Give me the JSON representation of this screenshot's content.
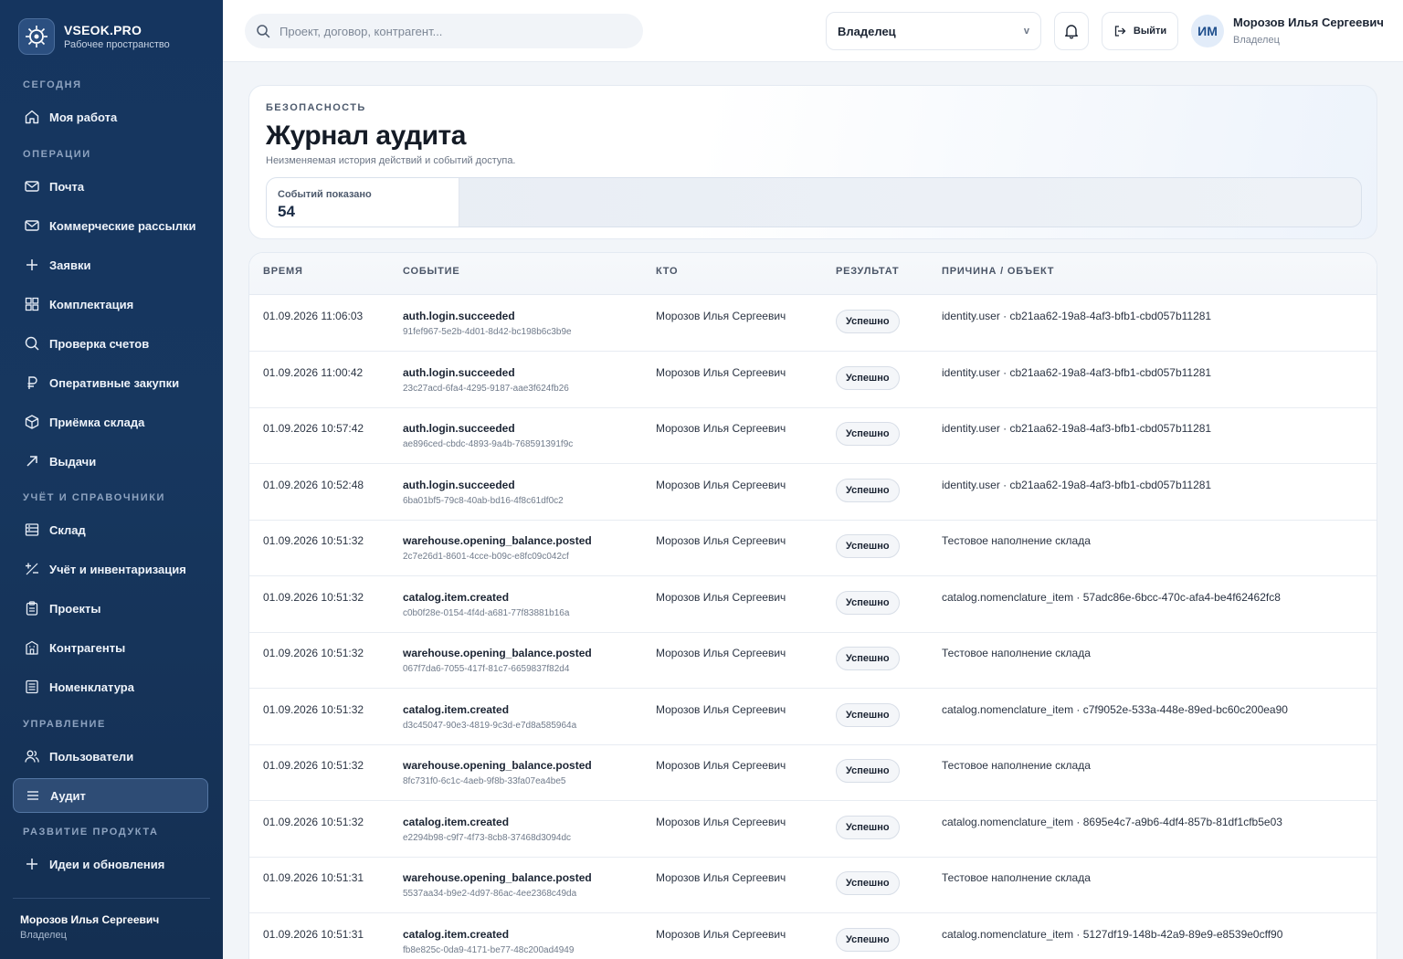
{
  "brand": {
    "name": "VSEOK.PRO",
    "subtitle": "Рабочее пространство"
  },
  "sidebar": {
    "sections": [
      {
        "title": "СЕГОДНЯ",
        "items": [
          {
            "label": "Моя работа",
            "icon": "home-icon"
          }
        ]
      },
      {
        "title": "ОПЕРАЦИИ",
        "items": [
          {
            "label": "Почта",
            "icon": "mail-icon"
          },
          {
            "label": "Коммерческие рассылки",
            "icon": "mail-icon"
          },
          {
            "label": "Заявки",
            "icon": "plus-icon"
          },
          {
            "label": "Комплектация",
            "icon": "grid-icon"
          },
          {
            "label": "Проверка счетов",
            "icon": "search-icon"
          },
          {
            "label": "Оперативные закупки",
            "icon": "ruble-icon"
          },
          {
            "label": "Приёмка склада",
            "icon": "box-icon"
          },
          {
            "label": "Выдачи",
            "icon": "arrow-up-right-icon"
          }
        ]
      },
      {
        "title": "УЧЁТ И СПРАВОЧНИКИ",
        "items": [
          {
            "label": "Склад",
            "icon": "warehouse-icon"
          },
          {
            "label": "Учёт и инвентаризация",
            "icon": "plus-minus-icon"
          },
          {
            "label": "Проекты",
            "icon": "clipboard-icon"
          },
          {
            "label": "Контрагенты",
            "icon": "building-icon"
          },
          {
            "label": "Номенклатура",
            "icon": "list-icon"
          }
        ]
      },
      {
        "title": "УПРАВЛЕНИЕ",
        "items": [
          {
            "label": "Пользователи",
            "icon": "users-icon"
          },
          {
            "label": "Аудит",
            "icon": "menu-icon",
            "active": true
          }
        ]
      },
      {
        "title": "РАЗВИТИЕ ПРОДУКТА",
        "items": [
          {
            "label": "Идеи и обновления",
            "icon": "plus-icon"
          }
        ]
      }
    ],
    "footer": {
      "name": "Морозов Илья Сергеевич",
      "role": "Владелец"
    }
  },
  "topbar": {
    "search_placeholder": "Проект, договор, контрагент...",
    "role_select": "Владелец",
    "role_chevron": "v",
    "logout_label": "Выйти",
    "avatar_initials": "ИМ",
    "user_name": "Морозов Илья Сергеевич",
    "user_role": "Владелец"
  },
  "header": {
    "eyebrow": "БЕЗОПАСНОСТЬ",
    "title": "Журнал аудита",
    "subtitle": "Неизменяемая история действий и событий доступа.",
    "stat_label": "Событий показано",
    "stat_value": "54"
  },
  "table": {
    "columns": [
      "ВРЕМЯ",
      "СОБЫТИЕ",
      "КТО",
      "РЕЗУЛЬТАТ",
      "ПРИЧИНА / ОБЪЕКТ"
    ],
    "rows": [
      {
        "time": "01.09.2026 11:06:03",
        "event": "auth.login.succeeded",
        "id": "91fef967-5e2b-4d01-8d42-bc198b6c3b9e",
        "who": "Морозов Илья Сергеевич",
        "result": "Успешно",
        "reason": "identity.user · cb21aa62-19a8-4af3-bfb1-cbd057b11281"
      },
      {
        "time": "01.09.2026 11:00:42",
        "event": "auth.login.succeeded",
        "id": "23c27acd-6fa4-4295-9187-aae3f624fb26",
        "who": "Морозов Илья Сергеевич",
        "result": "Успешно",
        "reason": "identity.user · cb21aa62-19a8-4af3-bfb1-cbd057b11281"
      },
      {
        "time": "01.09.2026 10:57:42",
        "event": "auth.login.succeeded",
        "id": "ae896ced-cbdc-4893-9a4b-768591391f9c",
        "who": "Морозов Илья Сергеевич",
        "result": "Успешно",
        "reason": "identity.user · cb21aa62-19a8-4af3-bfb1-cbd057b11281"
      },
      {
        "time": "01.09.2026 10:52:48",
        "event": "auth.login.succeeded",
        "id": "6ba01bf5-79c8-40ab-bd16-4f8c61df0c2",
        "who": "Морозов Илья Сергеевич",
        "result": "Успешно",
        "reason": "identity.user · cb21aa62-19a8-4af3-bfb1-cbd057b11281"
      },
      {
        "time": "01.09.2026 10:51:32",
        "event": "warehouse.opening_balance.posted",
        "id": "2c7e26d1-8601-4cce-b09c-e8fc09c042cf",
        "who": "Морозов Илья Сергеевич",
        "result": "Успешно",
        "reason": "Тестовое наполнение склада"
      },
      {
        "time": "01.09.2026 10:51:32",
        "event": "catalog.item.created",
        "id": "c0b0f28e-0154-4f4d-a681-77f83881b16a",
        "who": "Морозов Илья Сергеевич",
        "result": "Успешно",
        "reason": "catalog.nomenclature_item · 57adc86e-6bcc-470c-afa4-be4f62462fc8"
      },
      {
        "time": "01.09.2026 10:51:32",
        "event": "warehouse.opening_balance.posted",
        "id": "067f7da6-7055-417f-81c7-6659837f82d4",
        "who": "Морозов Илья Сергеевич",
        "result": "Успешно",
        "reason": "Тестовое наполнение склада"
      },
      {
        "time": "01.09.2026 10:51:32",
        "event": "catalog.item.created",
        "id": "d3c45047-90e3-4819-9c3d-e7d8a585964a",
        "who": "Морозов Илья Сергеевич",
        "result": "Успешно",
        "reason": "catalog.nomenclature_item · c7f9052e-533a-448e-89ed-bc60c200ea90"
      },
      {
        "time": "01.09.2026 10:51:32",
        "event": "warehouse.opening_balance.posted",
        "id": "8fc731f0-6c1c-4aeb-9f8b-33fa07ea4be5",
        "who": "Морозов Илья Сергеевич",
        "result": "Успешно",
        "reason": "Тестовое наполнение склада"
      },
      {
        "time": "01.09.2026 10:51:32",
        "event": "catalog.item.created",
        "id": "e2294b98-c9f7-4f73-8cb8-37468d3094dc",
        "who": "Морозов Илья Сергеевич",
        "result": "Успешно",
        "reason": "catalog.nomenclature_item · 8695e4c7-a9b6-4df4-857b-81df1cfb5e03"
      },
      {
        "time": "01.09.2026 10:51:31",
        "event": "warehouse.opening_balance.posted",
        "id": "5537aa34-b9e2-4d97-86ac-4ee2368c49da",
        "who": "Морозов Илья Сергеевич",
        "result": "Успешно",
        "reason": "Тестовое наполнение склада"
      },
      {
        "time": "01.09.2026 10:51:31",
        "event": "catalog.item.created",
        "id": "fb8e825c-0da9-4171-be77-48c200ad4949",
        "who": "Морозов Илья Сергеевич",
        "result": "Успешно",
        "reason": "catalog.nomenclature_item · 5127df19-148b-42a9-89e9-e8539e0cff90"
      }
    ]
  },
  "colors": {
    "sidebar": "#15355f",
    "accent": "#1f4f8d",
    "background": "#f2f5f9"
  }
}
